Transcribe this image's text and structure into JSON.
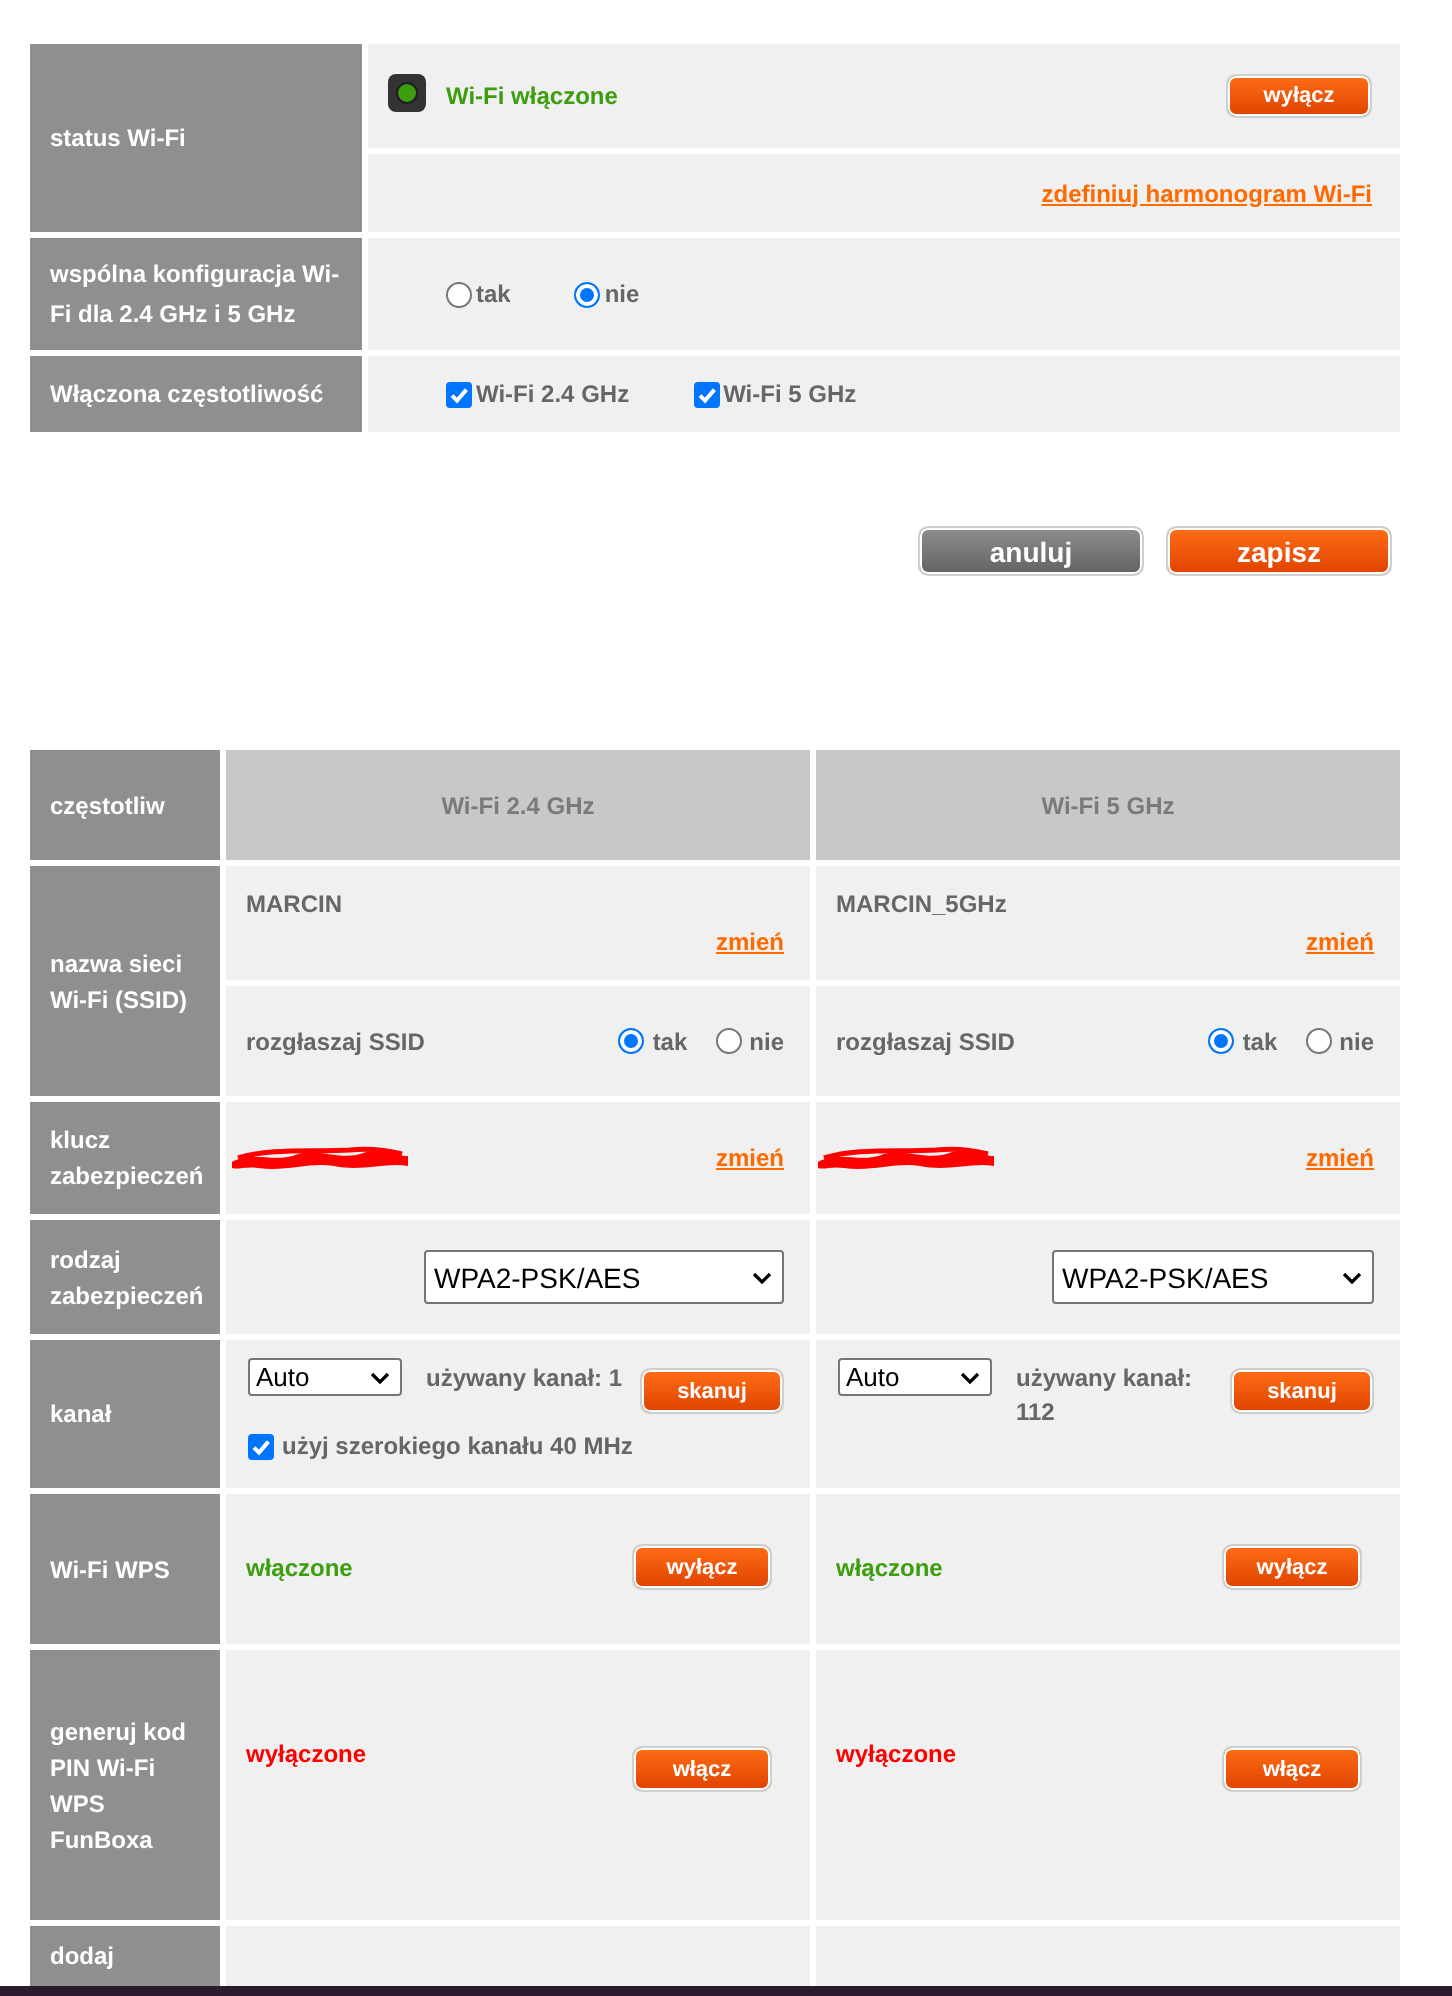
{
  "wifi_status": {
    "label": "status Wi-Fi",
    "on": true,
    "status_text": "Wi-Fi włączone",
    "toggle_button": "wyłącz",
    "schedule_link": "zdefiniuj harmonogram Wi-Fi"
  },
  "common_config": {
    "label": "wspólna konfiguracja Wi-Fi dla 2.4 GHz i 5 GHz",
    "options": [
      {
        "label": "tak",
        "selected": false
      },
      {
        "label": "nie",
        "selected": true
      }
    ]
  },
  "enabled_bands": {
    "label": "Włączona częstotliwość",
    "options": [
      {
        "label": "Wi-Fi 2.4 GHz",
        "checked": true
      },
      {
        "label": "Wi-Fi 5 GHz",
        "checked": true
      }
    ]
  },
  "form_buttons": [
    {
      "label": "anuluj",
      "kind": "cancel"
    },
    {
      "label": "zapisz",
      "kind": "save"
    }
  ],
  "band_table": {
    "row_labels": {
      "band": "częstotliw",
      "ssid": "nazwa sieci Wi-Fi (SSID)",
      "key": "klucz zabezpieczeń",
      "security": "rodzaj zabezpieczeń",
      "channel": "kanał",
      "wps": "Wi-Fi WPS",
      "wps_pin": "generuj kod PIN Wi-Fi WPS FunBoxa",
      "add": "dodaj"
    },
    "columns": [
      {
        "band": "Wi-Fi 2.4 GHz",
        "ssid": "MARCIN",
        "ssid_change_link": "zmień",
        "broadcast_label": "rozgłaszaj SSID",
        "broadcast_options": [
          {
            "label": "tak",
            "selected": true
          },
          {
            "label": "nie",
            "selected": false
          }
        ],
        "key_redacted": true,
        "key_change_link": "zmień",
        "security_type": "WPA2-PSK/AES",
        "channel": "Auto",
        "channel_in_use": "używany kanał: 1",
        "scan_button": "skanuj",
        "wide_channel": {
          "label": "użyj szerokiego kanału 40 MHz",
          "checked": true
        },
        "wps": {
          "on": true,
          "status": "włączone",
          "button": "wyłącz"
        },
        "wps_pin": {
          "on": false,
          "status": "wyłączone",
          "button": "włącz"
        }
      },
      {
        "band": "Wi-Fi 5 GHz",
        "ssid": "MARCIN_5GHz",
        "ssid_change_link": "zmień",
        "broadcast_label": "rozgłaszaj SSID",
        "broadcast_options": [
          {
            "label": "tak",
            "selected": true
          },
          {
            "label": "nie",
            "selected": false
          }
        ],
        "key_redacted": true,
        "key_change_link": "zmień",
        "security_type": "WPA2-PSK/AES",
        "channel": "Auto",
        "channel_in_use": "używany kanał: 112",
        "scan_button": "skanuj",
        "wps": {
          "on": true,
          "status": "włączone",
          "button": "wyłącz"
        },
        "wps_pin": {
          "on": false,
          "status": "wyłączone",
          "button": "włącz"
        }
      }
    ]
  }
}
